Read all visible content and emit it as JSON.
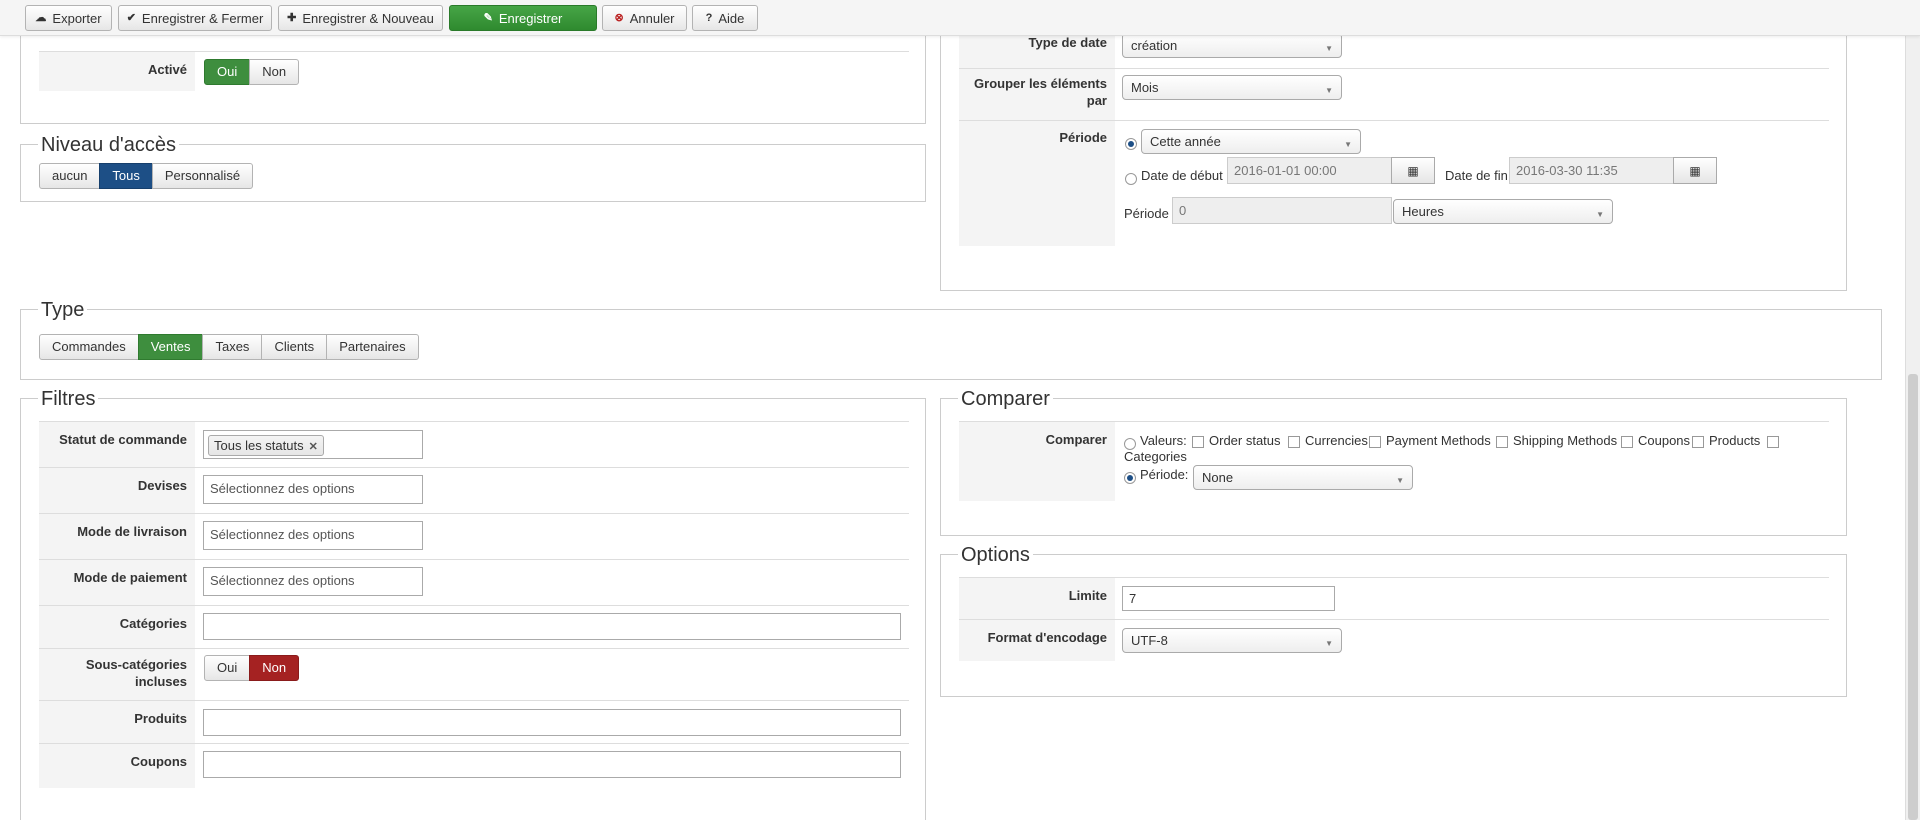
{
  "toolbar": {
    "export": "Exporter",
    "save_close": "Enregistrer & Fermer",
    "save_new": "Enregistrer & Nouveau",
    "save": "Enregistrer",
    "cancel": "Annuler",
    "help": "Aide"
  },
  "general": {
    "active_label": "Activé",
    "yes": "Oui",
    "no": "Non",
    "active_value": "Oui"
  },
  "access": {
    "legend": "Niveau d'accès",
    "options": [
      "aucun",
      "Tous",
      "Personnalisé"
    ],
    "selected": "Tous"
  },
  "date": {
    "type_label": "Type de date",
    "type_value": "création",
    "group_label": "Grouper les éléments par",
    "group_value": "Mois",
    "period_label": "Période",
    "period_value": "Cette année",
    "start_label": "Date de début",
    "start_value": "2016-01-01 00:00",
    "end_label": "Date de fin",
    "end_value": "2016-03-30 11:35",
    "period_num_label": "Période",
    "period_num_value": "0",
    "period_unit": "Heures"
  },
  "type": {
    "legend": "Type",
    "options": [
      "Commandes",
      "Ventes",
      "Taxes",
      "Clients",
      "Partenaires"
    ],
    "selected": "Ventes"
  },
  "filters": {
    "legend": "Filtres",
    "order_status_label": "Statut de commande",
    "order_status_tag": "Tous les statuts",
    "currencies_label": "Devises",
    "shipping_label": "Mode de livraison",
    "payment_label": "Mode de paiement",
    "placeholder": "Sélectionnez des options",
    "categories_label": "Catégories",
    "subcats_label": "Sous-catégories incluses",
    "subcats_yes": "Oui",
    "subcats_no": "Non",
    "subcats_value": "Non",
    "products_label": "Produits",
    "coupons_label": "Coupons"
  },
  "compare": {
    "legend": "Comparer",
    "label": "Comparer",
    "values_label": "Valeurs:",
    "checks": [
      "Order status",
      "Currencies",
      "Payment Methods",
      "Shipping Methods",
      "Coupons",
      "Products",
      "Categories"
    ],
    "period_label": "Période:",
    "period_value": "None"
  },
  "options": {
    "legend": "Options",
    "limit_label": "Limite",
    "limit_value": "7",
    "encoding_label": "Format d'encodage",
    "encoding_value": "UTF-8"
  },
  "icons": [
    "export-icon",
    "check-icon",
    "plus-icon",
    "edit-icon",
    "cancel-icon",
    "help-icon",
    "calendar-icon",
    "remove-icon",
    "chevron-down-icon"
  ],
  "colors": {
    "green": "#3e8e3e",
    "blue": "#1d4f86",
    "red": "#a52222"
  }
}
